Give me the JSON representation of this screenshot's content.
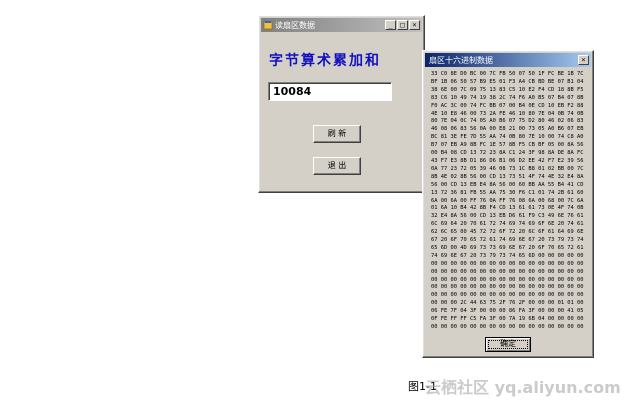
{
  "window1": {
    "title": "读扇区数据",
    "heading": "字节算术累加和",
    "result_value": "10084",
    "refresh_label": "刷 新",
    "exit_label": "退 出"
  },
  "window2": {
    "title": "扇区十六进制数据",
    "ok_label": "确定",
    "hex_text": "33 C0 8E D0 BC 00 7C FB 50 07 50 1F FC BE 1B 7C BF 1B 06 50 57 B9 E5 01 F3 A4 CB BD BE 07 B1 04 38 6E 00 7C 09 75 13 83 C5 10 E2 F4 CD 18 8B F5 83 C6 10 49 74 19 38 2C 74 F6 A0 B5 07 B4 07 8B F0 AC 3C 00 74 FC BB 07 00 B4 0E CD 10 EB F2 88 4E 10 E8 46 00 73 2A FE 46 10 80 7E 04 0B 74 0B 80 7E 04 0C 74 05 A0 B6 07 75 D2 80 46 02 06 83 46 08 06 83 56 0A 00 E8 21 00 73 05 A0 B6 07 EB BC 81 3E FE 7D 55 AA 74 0B 80 7E 10 00 74 C8 A0 B7 07 EB A9 8B FC 1E 57 8B F5 CB BF 05 00 8A 56 00 B4 08 CD 13 72 23 8A C1 24 3F 98 8A DE 8A FC 43 F7 E3 8B D1 86 D6 B1 06 D2 EE 42 F7 E2 39 56 0A 77 23 72 05 39 46 08 73 1C B8 01 02 BB 00 7C 8B 4E 02 8B 56 00 CD 13 73 51 4F 74 4E 32 E4 8A 56 00 CD 13 EB E4 8A 56 00 60 BB AA 55 B4 41 CD 13 72 36 81 FB 55 AA 75 30 F6 C1 01 74 2B 61 60 6A 00 6A 00 FF 76 0A FF 76 08 6A 00 68 00 7C 6A 01 6A 10 B4 42 8B F4 CD 13 61 61 73 0E 4F 74 0B 32 E4 8A 56 00 CD 13 EB D6 61 F9 C3 49 6E 76 61 6C 69 64 20 70 61 72 74 69 74 69 6F 6E 20 74 61 62 6C 65 00 45 72 72 6F 72 20 6C 6F 61 64 69 6E 67 20 6F 70 65 72 61 74 69 6E 67 20 73 79 73 74 65 6D 00 4D 69 73 73 69 6E 67 20 6F 70 65 72 61 74 69 6E 67 20 73 79 73 74 65 6D 00 00 00 00 00 00 00 00 00 00 00 00 00 00 00 00 00 00 00 00 00 00 00 00 00 00 00 00 00 00 00 00 00 00 00 00 00 00 00 00 00 00 00 00 00 00 00 00 00 00 00 00 00 00 00 00 00 00 00 00 00 00 00 00 00 00 00 00 00 00 00 00 00 00 00 00 00 00 00 00 00 00 00 00 00 00 00 00 2C 44 63 75 2F 76 2F 00 00 00 01 01 00 06 FE 7F 04 3F 00 00 00 86 FA 3F 00 00 00 41 05 0F FE FF FF C5 FA 3F 00 7A 19 6B 04 00 00 00 00 00 00 00 00 00 00 00 00 00 00 00 00 00 00 00 00 00 00 00 00 00 00 00 00 00 00 00 00 55 AA"
  },
  "caption": "图1-1",
  "watermark": "云栖社区 yq.aliyun.com"
}
